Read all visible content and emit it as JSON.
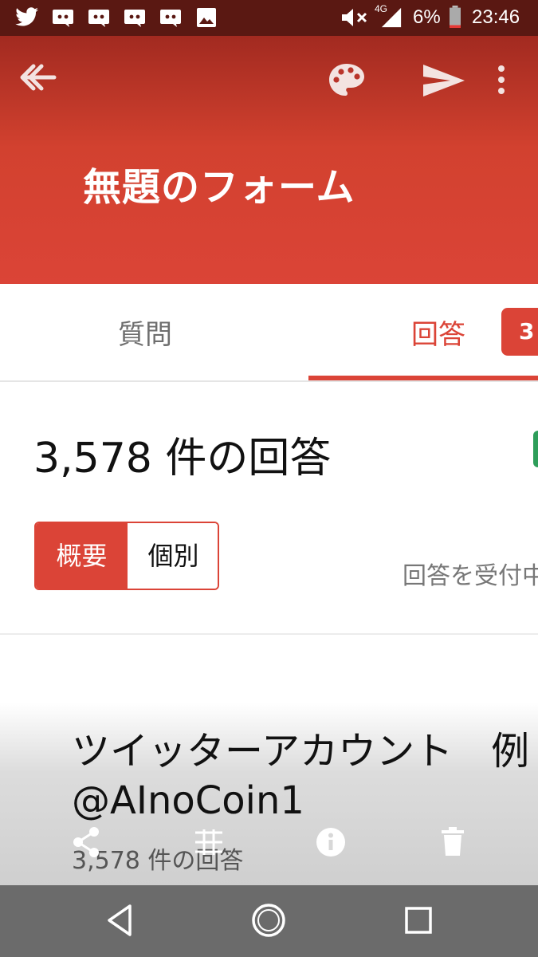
{
  "status_bar": {
    "network": "4G",
    "battery": "6%",
    "time": "23:46"
  },
  "app_bar": {
    "form_title": "無題のフォーム"
  },
  "tabs": {
    "questions_label": "質問",
    "responses_label": "回答",
    "badge_text": "3"
  },
  "summary": {
    "response_count": "3,578 件の回答",
    "view_summary": "概要",
    "view_individual": "個別",
    "accepting_text": "回答を受付中"
  },
  "question": {
    "title_line1": "ツイッターアカウント　例",
    "title_line2": "@AInoCoin1",
    "count": "3,578 件の回答"
  },
  "colors": {
    "accent": "#db4437",
    "status_bar": "#5a1812",
    "nav_bar": "#6b6b6b"
  }
}
